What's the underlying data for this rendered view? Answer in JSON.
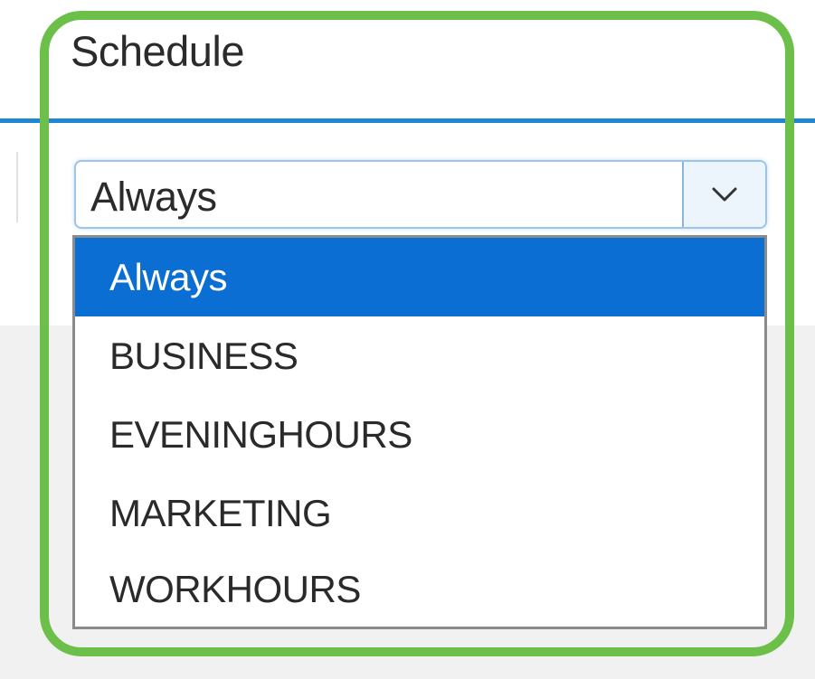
{
  "column": {
    "title": "Schedule"
  },
  "select": {
    "value": "Always",
    "arrow_icon": "chevron-down-icon"
  },
  "dropdown": {
    "options": [
      {
        "label": "Always",
        "selected": true
      },
      {
        "label": "BUSINESS",
        "selected": false
      },
      {
        "label": "EVENINGHOURS",
        "selected": false
      },
      {
        "label": "MARKETING",
        "selected": false
      },
      {
        "label": "WORKHOURS",
        "selected": false
      }
    ]
  },
  "colors": {
    "accent_rule": "#1f86d1",
    "selected_option": "#0a6ed3",
    "highlight_frame": "#6cc04a"
  }
}
